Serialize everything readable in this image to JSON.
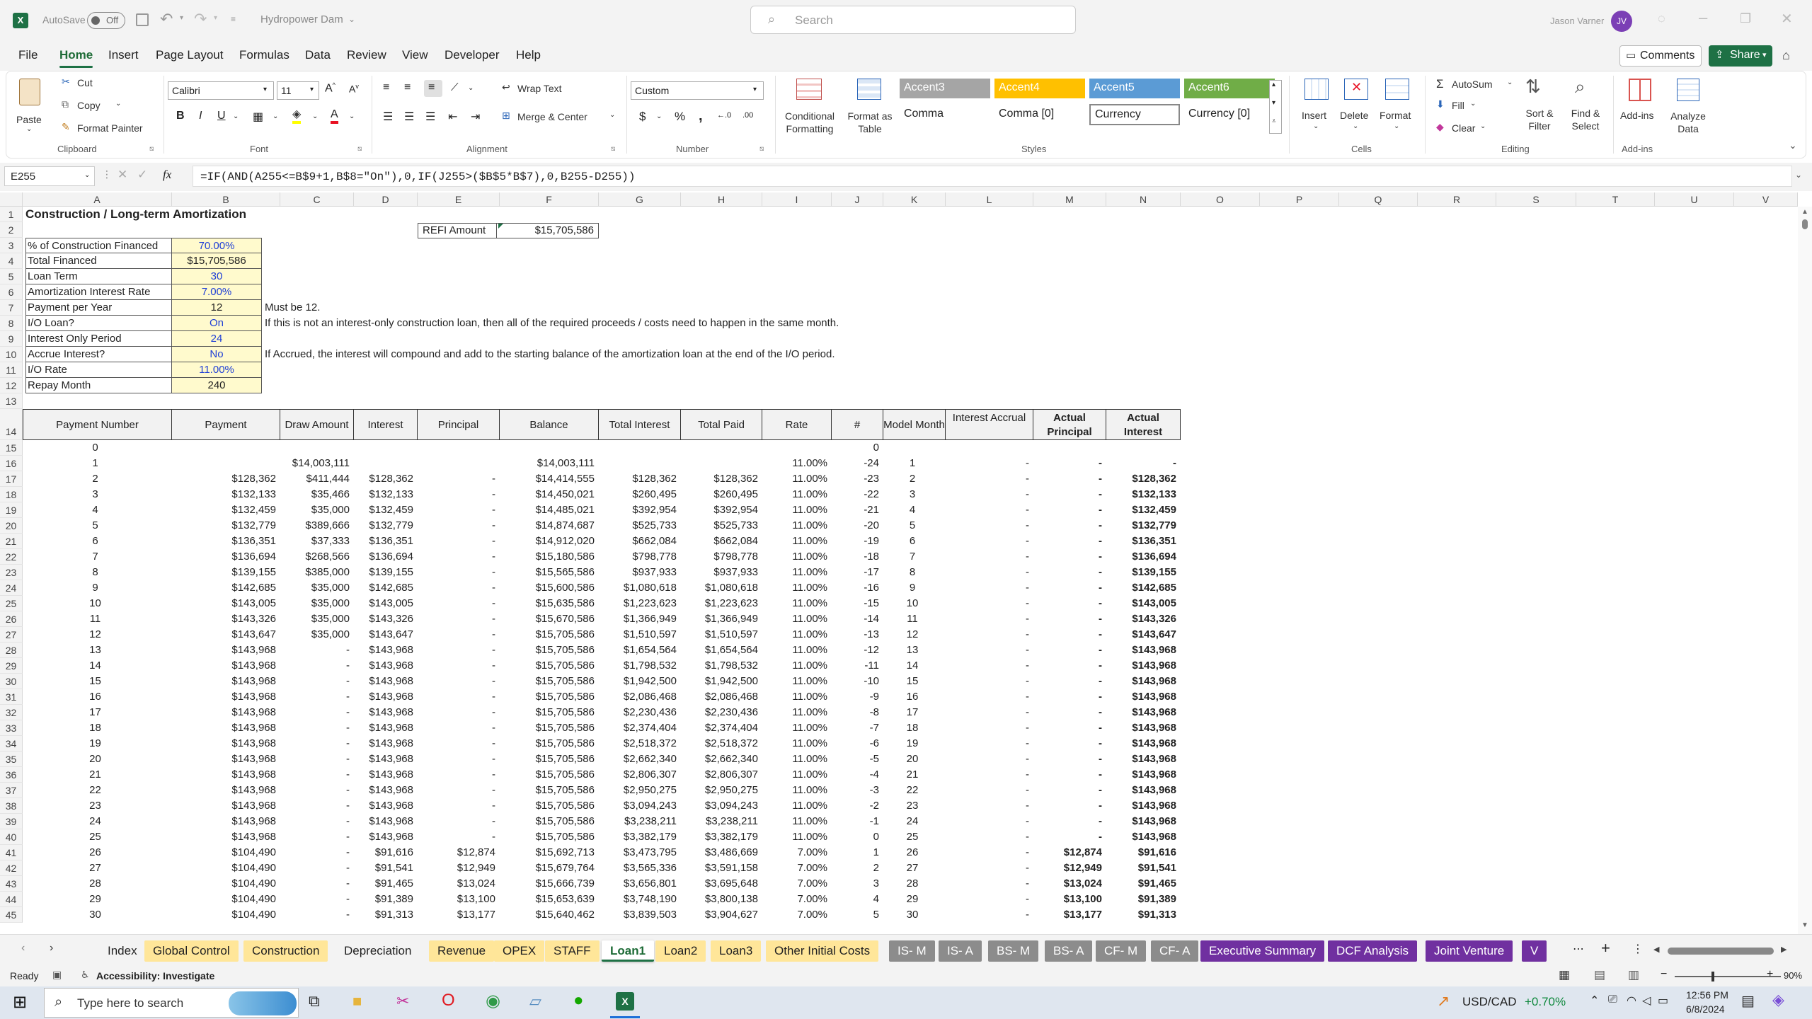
{
  "titlebar": {
    "autosave_label": "AutoSave",
    "autosave_state": "Off",
    "file_name": "Hydropower Dam",
    "search_placeholder": "Search",
    "user_name": "Jason Varner",
    "user_initials": "JV"
  },
  "menu": {
    "items": [
      "File",
      "Home",
      "Insert",
      "Page Layout",
      "Formulas",
      "Data",
      "Review",
      "View",
      "Developer",
      "Help"
    ],
    "active": "Home",
    "comments_label": "Comments",
    "share_label": "Share"
  },
  "ribbon": {
    "clipboard": {
      "paste": "Paste",
      "cut": "Cut",
      "copy": "Copy",
      "format_painter": "Format Painter",
      "group": "Clipboard"
    },
    "font": {
      "name": "Calibri",
      "size": "11",
      "group": "Font"
    },
    "alignment": {
      "wrap_text": "Wrap Text",
      "merge_center": "Merge & Center",
      "group": "Alignment"
    },
    "number": {
      "format": "Custom",
      "group": "Number"
    },
    "styles": {
      "conditional": "Conditional Formatting",
      "format_table": "Format as Table",
      "group": "Styles",
      "cells": [
        {
          "label": "Accent3",
          "bg": "#a5a5a5",
          "fg": "#ffffff"
        },
        {
          "label": "Accent4",
          "bg": "#ffc000",
          "fg": "#ffffff"
        },
        {
          "label": "Accent5",
          "bg": "#5b9bd5",
          "fg": "#ffffff"
        },
        {
          "label": "Accent6",
          "bg": "#70ad47",
          "fg": "#ffffff"
        },
        {
          "label": "Comma",
          "bg": "#ffffff",
          "fg": "#000000"
        },
        {
          "label": "Comma [0]",
          "bg": "#ffffff",
          "fg": "#000000"
        },
        {
          "label": "Currency",
          "bg": "#ffffff",
          "fg": "#000000"
        },
        {
          "label": "Currency [0]",
          "bg": "#ffffff",
          "fg": "#000000"
        }
      ]
    },
    "cells": {
      "insert": "Insert",
      "delete": "Delete",
      "format": "Format",
      "group": "Cells"
    },
    "editing": {
      "autosum": "AutoSum",
      "fill": "Fill",
      "clear": "Clear",
      "sort_filter": "Sort & Filter",
      "find_select": "Find & Select",
      "group": "Editing"
    },
    "addins": {
      "addins": "Add-ins",
      "analyze": "Analyze Data",
      "group": "Add-ins"
    }
  },
  "formula_bar": {
    "name_box": "E255",
    "fx": "fx",
    "formula": "=IF(AND(A255<=B$9+1,B$8=\"On\"),0,IF(J255>($B$5*B$7),0,B255-D255))"
  },
  "columns": [
    "A",
    "B",
    "C",
    "D",
    "E",
    "F",
    "G",
    "H",
    "I",
    "J",
    "K",
    "L",
    "M",
    "N",
    "O",
    "P",
    "Q",
    "R",
    "S",
    "T",
    "U",
    "V"
  ],
  "inputs": {
    "title": "Construction / Long-term Amortization",
    "refi_label": "REFI Amount",
    "refi_value": "$15,705,586",
    "rows": [
      {
        "label": "% of Construction Financed",
        "value": "70.00%",
        "blue": true,
        "note": ""
      },
      {
        "label": "Total Financed",
        "value": "$15,705,586",
        "blue": false,
        "note": ""
      },
      {
        "label": "Loan Term",
        "value": "30",
        "blue": true,
        "note": ""
      },
      {
        "label": "Amortization Interest Rate",
        "value": "7.00%",
        "blue": true,
        "note": ""
      },
      {
        "label": "Payment per Year",
        "value": "12",
        "blue": false,
        "note": "Must be 12."
      },
      {
        "label": "I/O Loan?",
        "value": "On",
        "blue": true,
        "note": "If this is not an interest-only construction loan, then all of the required proceeds / costs need to happen in the same month."
      },
      {
        "label": "Interest Only Period",
        "value": "24",
        "blue": true,
        "note": ""
      },
      {
        "label": "Accrue Interest?",
        "value": "No",
        "blue": true,
        "note": " If Accrued, the interest will compound and add to the starting balance of the amortization loan at the end of the I/O period."
      },
      {
        "label": "I/O Rate",
        "value": "11.00%",
        "blue": true,
        "note": ""
      },
      {
        "label": "Repay Month",
        "value": "240",
        "blue": false,
        "note": ""
      }
    ]
  },
  "table": {
    "headers": [
      "Payment Number",
      "Payment",
      "Draw Amount",
      "Interest",
      "Principal",
      "Balance",
      "Total Interest",
      "Total Paid",
      "Rate",
      "#",
      "Model Month",
      "Interest Accrual",
      "Actual Principal",
      "Actual Interest"
    ],
    "rows": [
      [
        "0",
        "",
        "",
        "",
        "",
        "",
        "",
        "",
        "",
        "0",
        "",
        "",
        "",
        ""
      ],
      [
        "1",
        "",
        "$14,003,111",
        "",
        "",
        "$14,003,111",
        "",
        "",
        "11.00%",
        "-24",
        "1",
        "-",
        "-",
        "-"
      ],
      [
        "2",
        "$128,362",
        "$411,444",
        "$128,362",
        "-",
        "$14,414,555",
        "$128,362",
        "$128,362",
        "11.00%",
        "-23",
        "2",
        "-",
        "-",
        "$128,362"
      ],
      [
        "3",
        "$132,133",
        "$35,466",
        "$132,133",
        "-",
        "$14,450,021",
        "$260,495",
        "$260,495",
        "11.00%",
        "-22",
        "3",
        "-",
        "-",
        "$132,133"
      ],
      [
        "4",
        "$132,459",
        "$35,000",
        "$132,459",
        "-",
        "$14,485,021",
        "$392,954",
        "$392,954",
        "11.00%",
        "-21",
        "4",
        "-",
        "-",
        "$132,459"
      ],
      [
        "5",
        "$132,779",
        "$389,666",
        "$132,779",
        "-",
        "$14,874,687",
        "$525,733",
        "$525,733",
        "11.00%",
        "-20",
        "5",
        "-",
        "-",
        "$132,779"
      ],
      [
        "6",
        "$136,351",
        "$37,333",
        "$136,351",
        "-",
        "$14,912,020",
        "$662,084",
        "$662,084",
        "11.00%",
        "-19",
        "6",
        "-",
        "-",
        "$136,351"
      ],
      [
        "7",
        "$136,694",
        "$268,566",
        "$136,694",
        "-",
        "$15,180,586",
        "$798,778",
        "$798,778",
        "11.00%",
        "-18",
        "7",
        "-",
        "-",
        "$136,694"
      ],
      [
        "8",
        "$139,155",
        "$385,000",
        "$139,155",
        "-",
        "$15,565,586",
        "$937,933",
        "$937,933",
        "11.00%",
        "-17",
        "8",
        "-",
        "-",
        "$139,155"
      ],
      [
        "9",
        "$142,685",
        "$35,000",
        "$142,685",
        "-",
        "$15,600,586",
        "$1,080,618",
        "$1,080,618",
        "11.00%",
        "-16",
        "9",
        "-",
        "-",
        "$142,685"
      ],
      [
        "10",
        "$143,005",
        "$35,000",
        "$143,005",
        "-",
        "$15,635,586",
        "$1,223,623",
        "$1,223,623",
        "11.00%",
        "-15",
        "10",
        "-",
        "-",
        "$143,005"
      ],
      [
        "11",
        "$143,326",
        "$35,000",
        "$143,326",
        "-",
        "$15,670,586",
        "$1,366,949",
        "$1,366,949",
        "11.00%",
        "-14",
        "11",
        "-",
        "-",
        "$143,326"
      ],
      [
        "12",
        "$143,647",
        "$35,000",
        "$143,647",
        "-",
        "$15,705,586",
        "$1,510,597",
        "$1,510,597",
        "11.00%",
        "-13",
        "12",
        "-",
        "-",
        "$143,647"
      ],
      [
        "13",
        "$143,968",
        "-",
        "$143,968",
        "-",
        "$15,705,586",
        "$1,654,564",
        "$1,654,564",
        "11.00%",
        "-12",
        "13",
        "-",
        "-",
        "$143,968"
      ],
      [
        "14",
        "$143,968",
        "-",
        "$143,968",
        "-",
        "$15,705,586",
        "$1,798,532",
        "$1,798,532",
        "11.00%",
        "-11",
        "14",
        "-",
        "-",
        "$143,968"
      ],
      [
        "15",
        "$143,968",
        "-",
        "$143,968",
        "-",
        "$15,705,586",
        "$1,942,500",
        "$1,942,500",
        "11.00%",
        "-10",
        "15",
        "-",
        "-",
        "$143,968"
      ],
      [
        "16",
        "$143,968",
        "-",
        "$143,968",
        "-",
        "$15,705,586",
        "$2,086,468",
        "$2,086,468",
        "11.00%",
        "-9",
        "16",
        "-",
        "-",
        "$143,968"
      ],
      [
        "17",
        "$143,968",
        "-",
        "$143,968",
        "-",
        "$15,705,586",
        "$2,230,436",
        "$2,230,436",
        "11.00%",
        "-8",
        "17",
        "-",
        "-",
        "$143,968"
      ],
      [
        "18",
        "$143,968",
        "-",
        "$143,968",
        "-",
        "$15,705,586",
        "$2,374,404",
        "$2,374,404",
        "11.00%",
        "-7",
        "18",
        "-",
        "-",
        "$143,968"
      ],
      [
        "19",
        "$143,968",
        "-",
        "$143,968",
        "-",
        "$15,705,586",
        "$2,518,372",
        "$2,518,372",
        "11.00%",
        "-6",
        "19",
        "-",
        "-",
        "$143,968"
      ],
      [
        "20",
        "$143,968",
        "-",
        "$143,968",
        "-",
        "$15,705,586",
        "$2,662,340",
        "$2,662,340",
        "11.00%",
        "-5",
        "20",
        "-",
        "-",
        "$143,968"
      ],
      [
        "21",
        "$143,968",
        "-",
        "$143,968",
        "-",
        "$15,705,586",
        "$2,806,307",
        "$2,806,307",
        "11.00%",
        "-4",
        "21",
        "-",
        "-",
        "$143,968"
      ],
      [
        "22",
        "$143,968",
        "-",
        "$143,968",
        "-",
        "$15,705,586",
        "$2,950,275",
        "$2,950,275",
        "11.00%",
        "-3",
        "22",
        "-",
        "-",
        "$143,968"
      ],
      [
        "23",
        "$143,968",
        "-",
        "$143,968",
        "-",
        "$15,705,586",
        "$3,094,243",
        "$3,094,243",
        "11.00%",
        "-2",
        "23",
        "-",
        "-",
        "$143,968"
      ],
      [
        "24",
        "$143,968",
        "-",
        "$143,968",
        "-",
        "$15,705,586",
        "$3,238,211",
        "$3,238,211",
        "11.00%",
        "-1",
        "24",
        "-",
        "-",
        "$143,968"
      ],
      [
        "25",
        "$143,968",
        "-",
        "$143,968",
        "-",
        "$15,705,586",
        "$3,382,179",
        "$3,382,179",
        "11.00%",
        "0",
        "25",
        "-",
        "-",
        "$143,968"
      ],
      [
        "26",
        "$104,490",
        "-",
        "$91,616",
        "$12,874",
        "$15,692,713",
        "$3,473,795",
        "$3,486,669",
        "7.00%",
        "1",
        "26",
        "-",
        "$12,874",
        "$91,616"
      ],
      [
        "27",
        "$104,490",
        "-",
        "$91,541",
        "$12,949",
        "$15,679,764",
        "$3,565,336",
        "$3,591,158",
        "7.00%",
        "2",
        "27",
        "-",
        "$12,949",
        "$91,541"
      ],
      [
        "28",
        "$104,490",
        "-",
        "$91,465",
        "$13,024",
        "$15,666,739",
        "$3,656,801",
        "$3,695,648",
        "7.00%",
        "3",
        "28",
        "-",
        "$13,024",
        "$91,465"
      ],
      [
        "29",
        "$104,490",
        "-",
        "$91,389",
        "$13,100",
        "$15,653,639",
        "$3,748,190",
        "$3,800,138",
        "7.00%",
        "4",
        "29",
        "-",
        "$13,100",
        "$91,389"
      ],
      [
        "30",
        "$104,490",
        "-",
        "$91,313",
        "$13,177",
        "$15,640,462",
        "$3,839,503",
        "$3,904,627",
        "7.00%",
        "5",
        "30",
        "-",
        "$13,177",
        "$91,313"
      ]
    ]
  },
  "sheet_tabs": [
    {
      "label": "Index",
      "bg": "#f3f3f3",
      "fg": "#222222",
      "active": false
    },
    {
      "label": "Global Control",
      "bg": "#ffe699",
      "fg": "#222222",
      "active": false
    },
    {
      "label": "Construction",
      "bg": "#ffe699",
      "fg": "#222222",
      "active": false
    },
    {
      "label": "Depreciation",
      "bg": "#f3f3f3",
      "fg": "#222222",
      "active": false
    },
    {
      "label": "Revenue",
      "bg": "#ffe699",
      "fg": "#222222",
      "active": false
    },
    {
      "label": "OPEX",
      "bg": "#ffe699",
      "fg": "#222222",
      "active": false
    },
    {
      "label": "STAFF",
      "bg": "#ffe699",
      "fg": "#222222",
      "active": false
    },
    {
      "label": "Loan1",
      "bg": "#ffffff",
      "fg": "#1d6b36",
      "active": true
    },
    {
      "label": "Loan2",
      "bg": "#ffe699",
      "fg": "#222222",
      "active": false
    },
    {
      "label": "Loan3",
      "bg": "#ffe699",
      "fg": "#222222",
      "active": false
    },
    {
      "label": "Other Initial Costs",
      "bg": "#ffe699",
      "fg": "#222222",
      "active": false
    },
    {
      "label": "IS- M",
      "bg": "#8c8c8c",
      "fg": "#ffffff",
      "active": false
    },
    {
      "label": "IS- A",
      "bg": "#8c8c8c",
      "fg": "#ffffff",
      "active": false
    },
    {
      "label": "BS- M",
      "bg": "#8c8c8c",
      "fg": "#ffffff",
      "active": false
    },
    {
      "label": "BS- A",
      "bg": "#8c8c8c",
      "fg": "#ffffff",
      "active": false
    },
    {
      "label": "CF- M",
      "bg": "#8c8c8c",
      "fg": "#ffffff",
      "active": false
    },
    {
      "label": "CF- A",
      "bg": "#8c8c8c",
      "fg": "#ffffff",
      "active": false
    },
    {
      "label": "Executive Summary",
      "bg": "#7030a0",
      "fg": "#ffffff",
      "active": false
    },
    {
      "label": "DCF Analysis",
      "bg": "#7030a0",
      "fg": "#ffffff",
      "active": false
    },
    {
      "label": "Joint Venture",
      "bg": "#7030a0",
      "fg": "#ffffff",
      "active": false
    },
    {
      "label": "V",
      "bg": "#7030a0",
      "fg": "#ffffff",
      "active": false
    }
  ],
  "status": {
    "ready": "Ready",
    "accessibility": "Accessibility: Investigate",
    "zoom": "90%"
  },
  "taskbar": {
    "search_placeholder": "Type here to search",
    "ticker": "USD/CAD",
    "ticker_change": "+0.70%",
    "time": "12:56 PM",
    "date": "6/8/2024"
  }
}
